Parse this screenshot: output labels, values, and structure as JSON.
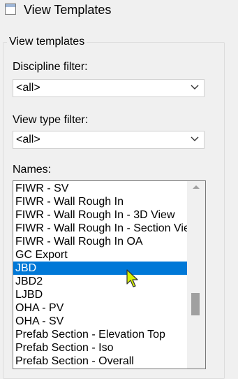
{
  "window": {
    "title": "View Templates",
    "icon": "window-icon"
  },
  "group": {
    "legend": "View templates"
  },
  "discipline": {
    "label": "Discipline filter:",
    "value": "<all>"
  },
  "view_type": {
    "label": "View type filter:",
    "value": "<all>"
  },
  "names": {
    "label": "Names:",
    "items": [
      "FIWR - SV",
      "FIWR - Wall Rough In",
      "FIWR - Wall Rough In - 3D View",
      "FIWR - Wall Rough In - Section View",
      "FIWR - Wall Rough In OA",
      "GC Export",
      "JBD",
      "JBD2",
      "LJBD",
      "OHA - PV",
      "OHA - SV",
      "Prefab Section - Elevation Top",
      "Prefab Section - Iso",
      "Prefab Section - Overall"
    ],
    "selected": "JBD"
  },
  "colors": {
    "selection": "#0078d7",
    "cursor": "#d4f000"
  }
}
